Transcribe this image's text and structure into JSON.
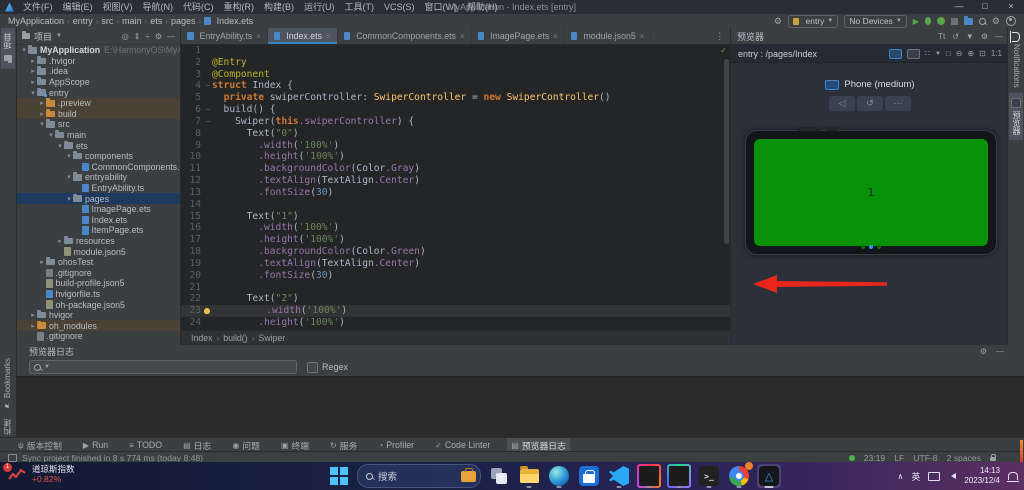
{
  "window": {
    "title": "MyApplication - Index.ets [entry]",
    "menus": [
      "文件(F)",
      "编辑(E)",
      "视图(V)",
      "导航(N)",
      "代码(C)",
      "重构(R)",
      "构建(B)",
      "运行(U)",
      "工具(T)",
      "VCS(S)",
      "窗口(W)",
      "帮助(H)"
    ],
    "controls": {
      "minimize": "—",
      "maximize": "□",
      "close": "×"
    }
  },
  "toolbar": {
    "breadcrumbs": [
      "MyApplication",
      "entry",
      "src",
      "main",
      "ets",
      "pages",
      "Index.ets"
    ],
    "module_selector": "entry",
    "device_selector": "No Devices"
  },
  "left_bar": {
    "project_label": "项目",
    "bookmarks_label": "Bookmarks",
    "build_label": "构建"
  },
  "right_bar": {
    "notifications_label": "Notifications",
    "previewer_label": "预览器"
  },
  "project": {
    "header": "项目",
    "tree": [
      {
        "label": "MyApplication",
        "path": " E:\\HarmonyOS\\MyApplicatio",
        "level": 0,
        "chevron": "open",
        "icon": "folder",
        "bold": true
      },
      {
        "label": ".hvigor",
        "level": 1,
        "chevron": "closed",
        "icon": "folder"
      },
      {
        "label": ".idea",
        "level": 1,
        "chevron": "closed",
        "icon": "folder"
      },
      {
        "label": "AppScope",
        "level": 1,
        "chevron": "closed",
        "icon": "folder"
      },
      {
        "label": "entry",
        "level": 1,
        "chevron": "open",
        "icon": "folder-mod"
      },
      {
        "label": ".preview",
        "level": 2,
        "chevron": "closed",
        "icon": "folder-ex",
        "tint": true
      },
      {
        "label": "build",
        "level": 2,
        "chevron": "closed",
        "icon": "folder-ex",
        "tint": true
      },
      {
        "label": "src",
        "level": 2,
        "chevron": "open",
        "icon": "folder"
      },
      {
        "label": "main",
        "level": 3,
        "chevron": "open",
        "icon": "folder"
      },
      {
        "label": "ets",
        "level": 4,
        "chevron": "open",
        "icon": "folder"
      },
      {
        "label": "components",
        "level": 5,
        "chevron": "open",
        "icon": "folder"
      },
      {
        "label": "CommonComponents.ets",
        "level": 6,
        "chevron": "none",
        "icon": "ets"
      },
      {
        "label": "entryability",
        "level": 5,
        "chevron": "open",
        "icon": "folder"
      },
      {
        "label": "EntryAbility.ts",
        "level": 6,
        "chevron": "none",
        "icon": "ets"
      },
      {
        "label": "pages",
        "level": 5,
        "chevron": "open",
        "icon": "folder",
        "selected": true
      },
      {
        "label": "ImagePage.ets",
        "level": 6,
        "chevron": "none",
        "icon": "ets"
      },
      {
        "label": "Index.ets",
        "level": 6,
        "chevron": "none",
        "icon": "ets"
      },
      {
        "label": "ItemPage.ets",
        "level": 6,
        "chevron": "none",
        "icon": "ets"
      },
      {
        "label": "resources",
        "level": 4,
        "chevron": "closed",
        "icon": "folder"
      },
      {
        "label": "module.json5",
        "level": 4,
        "chevron": "none",
        "icon": "json"
      },
      {
        "label": "ohosTest",
        "level": 2,
        "chevron": "closed",
        "icon": "folder"
      },
      {
        "label": ".gitignore",
        "level": 2,
        "chevron": "none",
        "icon": "git"
      },
      {
        "label": "build-profile.json5",
        "level": 2,
        "chevron": "none",
        "icon": "json"
      },
      {
        "label": "hvigorfile.ts",
        "level": 2,
        "chevron": "none",
        "icon": "ets"
      },
      {
        "label": "oh-package.json5",
        "level": 2,
        "chevron": "none",
        "icon": "json"
      },
      {
        "label": "hvigor",
        "level": 1,
        "chevron": "closed",
        "icon": "folder"
      },
      {
        "label": "oh_modules",
        "level": 1,
        "chevron": "closed",
        "icon": "folder-ex",
        "tint": true
      },
      {
        "label": ".gitignore",
        "level": 1,
        "chevron": "none",
        "icon": "git"
      }
    ]
  },
  "editor": {
    "tabs": [
      {
        "label": "EntryAbility.ts",
        "active": false
      },
      {
        "label": "Index.ets",
        "active": true
      },
      {
        "label": "CommonComponents.ets",
        "active": false
      },
      {
        "label": "ImagePage.ets",
        "active": false
      },
      {
        "label": "module.json5",
        "active": false
      }
    ],
    "lines": [
      "",
      "@Entry",
      "@Component",
      "struct Index {",
      "  private swiperController: SwiperController = new SwiperController()",
      "  build() {",
      "    Swiper(this.swiperController) {",
      "      Text(\"0\")",
      "        .width('100%')",
      "        .height('100%')",
      "        .backgroundColor(Color.Gray)",
      "        .textAlign(TextAlign.Center)",
      "        .fontSize(30)",
      "",
      "      Text(\"1\")",
      "        .width('100%')",
      "        .height('100%')",
      "        .backgroundColor(Color.Green)",
      "        .textAlign(TextAlign.Center)",
      "        .fontSize(30)",
      "",
      "      Text(\"2\")",
      "        .width('100%')",
      "        .height('100%')"
    ],
    "caret_line": 23,
    "bulb_line": 23,
    "fold_lines": [
      4,
      6,
      7
    ],
    "breadcrumb": [
      "Index",
      "build()",
      "Swiper"
    ]
  },
  "previewer": {
    "title": "预览器",
    "target": "entry : /pages/Index",
    "device_label": "Phone (medium)",
    "zoom_label": "1:1",
    "screen_label": "1",
    "indicator": {
      "count": 3,
      "active_index": 1
    },
    "screen_color": "#089208",
    "arrow_color": "#e8261c"
  },
  "log_panel": {
    "title": "预览器日志",
    "search_placeholder": "",
    "regex_label": "Regex"
  },
  "toolwindow_bar": {
    "items": [
      {
        "label": "版本控制",
        "glyph": "ψ",
        "active": false
      },
      {
        "label": "Run",
        "glyph": "▶",
        "active": false
      },
      {
        "label": "TODO",
        "glyph": "≡",
        "active": false
      },
      {
        "label": "日志",
        "glyph": "▤",
        "active": false
      },
      {
        "label": "问题",
        "glyph": "◉",
        "active": false
      },
      {
        "label": "终端",
        "glyph": "▣",
        "active": false
      },
      {
        "label": "服务",
        "glyph": "↻",
        "active": false
      },
      {
        "label": "Profiler",
        "glyph": "◔",
        "active": false
      },
      {
        "label": "Code Linter",
        "glyph": "✓",
        "active": false
      },
      {
        "label": "预览器日志",
        "glyph": "▤",
        "active": true
      }
    ]
  },
  "status_bar": {
    "message": "Sync project finished in 8 s 774 ms (today 8:48)",
    "caret_position": "23:19",
    "line_ending": "LF",
    "encoding": "UTF-8",
    "indent": "2 spaces"
  },
  "taskbar": {
    "widget": {
      "badge": "1",
      "title": "道琼斯指数",
      "change": "+0.82%"
    },
    "search_label": "搜索",
    "apps": [
      {
        "id": "file-explorer",
        "running": true
      },
      {
        "id": "edge",
        "running": true
      },
      {
        "id": "store",
        "running": false
      },
      {
        "id": "vscode",
        "running": true
      },
      {
        "id": "intellij",
        "running": true
      },
      {
        "id": "datagrip",
        "running": true
      },
      {
        "id": "terminal",
        "running": true
      },
      {
        "id": "chrome",
        "running": true
      },
      {
        "id": "deveco",
        "running": true,
        "active": true
      }
    ],
    "tray": {
      "ime": "英",
      "time": "14:13",
      "date": "2023/12/4"
    }
  },
  "glyphs": {
    "chevron-closed": "▸",
    "chevron-open": "▾",
    "crumb-sep": "›",
    "dropdown-caret": "▼",
    "gear": "⚙",
    "minus": "—",
    "locate": "◎",
    "expand": "⇕",
    "collapse": "÷",
    "refresh": "↺",
    "text-size": "Tt",
    "download": "▼",
    "grid": "∷",
    "fit": "□",
    "zoom-out": "⊖",
    "zoom-in": "⊕",
    "frame": "⊡",
    "back": "◁",
    "rotate": "↺",
    "more": "⋯",
    "tabs-more": "⋮",
    "run": "▶",
    "check": "✓",
    "bookmark-flag": "⚑",
    "hammer": "⚒",
    "chevron-up": "∧",
    "terminal-prompt": "&gt;_",
    "deveco-mark": "△"
  }
}
